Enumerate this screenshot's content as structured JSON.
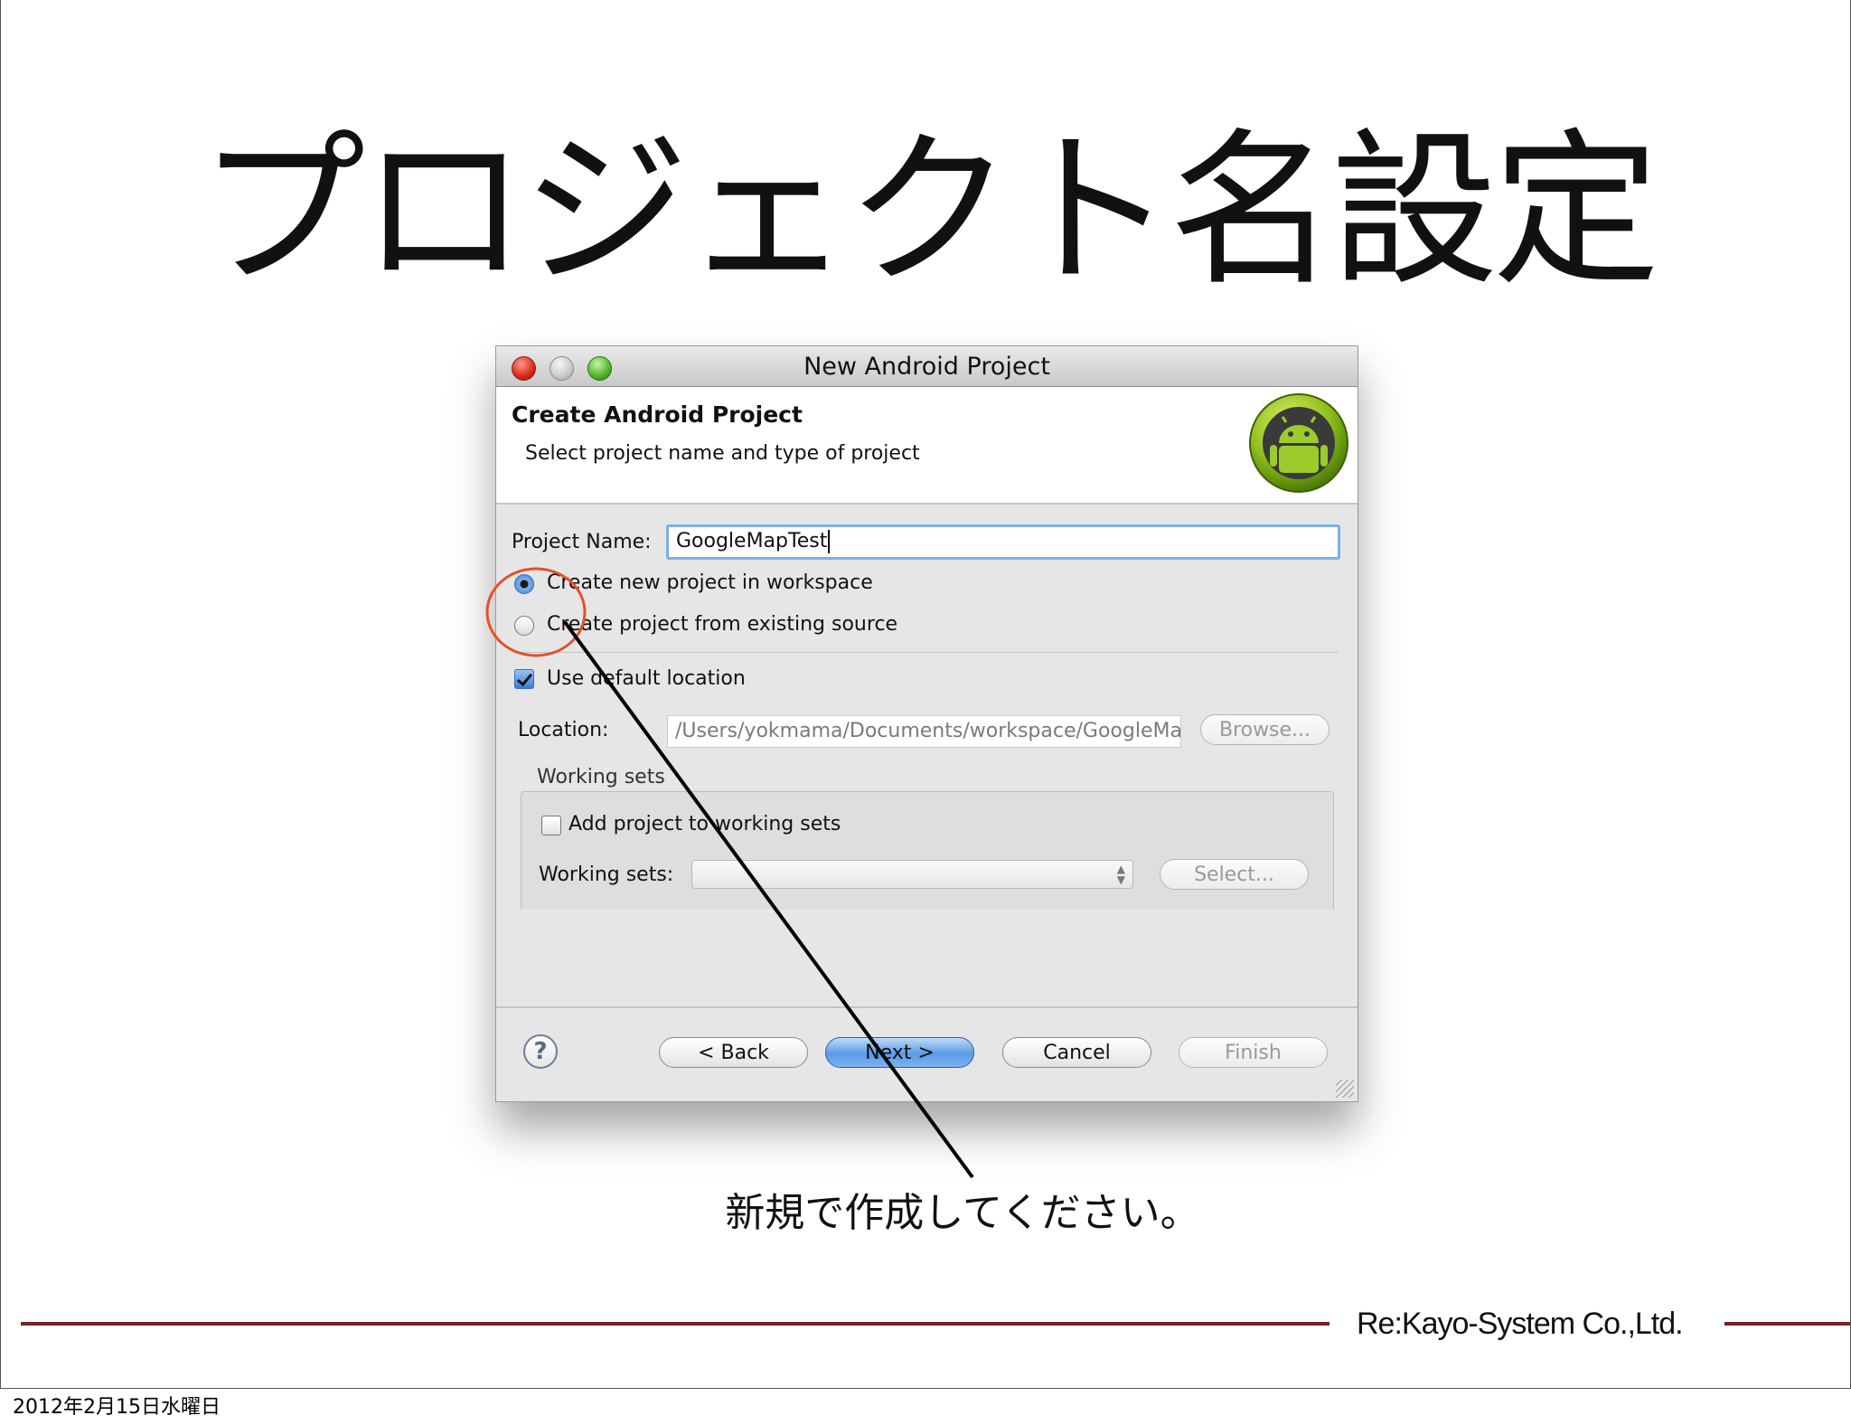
{
  "slide": {
    "title": "プロジェクト名設定",
    "caption": "新規で作成してください。",
    "company": "Re:Kayo-System Co.,Ltd.",
    "date": "2012年2月15日水曜日"
  },
  "window": {
    "title": "New Android Project"
  },
  "header": {
    "title": "Create Android Project",
    "subtitle": "Select project name and type of project",
    "logo_icon": "android-logo"
  },
  "form": {
    "project_name_label": "Project Name:",
    "project_name_value": "GoogleMapTest",
    "radio_new": "Create new project in workspace",
    "radio_existing": "Create project from existing source",
    "radio_selected": "new",
    "use_default_location": "Use default location",
    "use_default_checked": true,
    "location_label": "Location:",
    "location_value": "/Users/yokmama/Documents/workspace/GoogleMa",
    "browse_button": "Browse...",
    "working_sets_group": "Working sets",
    "add_to_working_sets": "Add project to working sets",
    "add_to_working_sets_checked": false,
    "working_sets_label": "Working sets:",
    "select_button": "Select..."
  },
  "buttons": {
    "back": "< Back",
    "next": "Next >",
    "cancel": "Cancel",
    "finish": "Finish",
    "help_icon": "?"
  },
  "colors": {
    "annotation_circle": "#e2512a",
    "annotation_line": "#000000",
    "rule": "#7a2328",
    "focus": "#7eaee8"
  }
}
